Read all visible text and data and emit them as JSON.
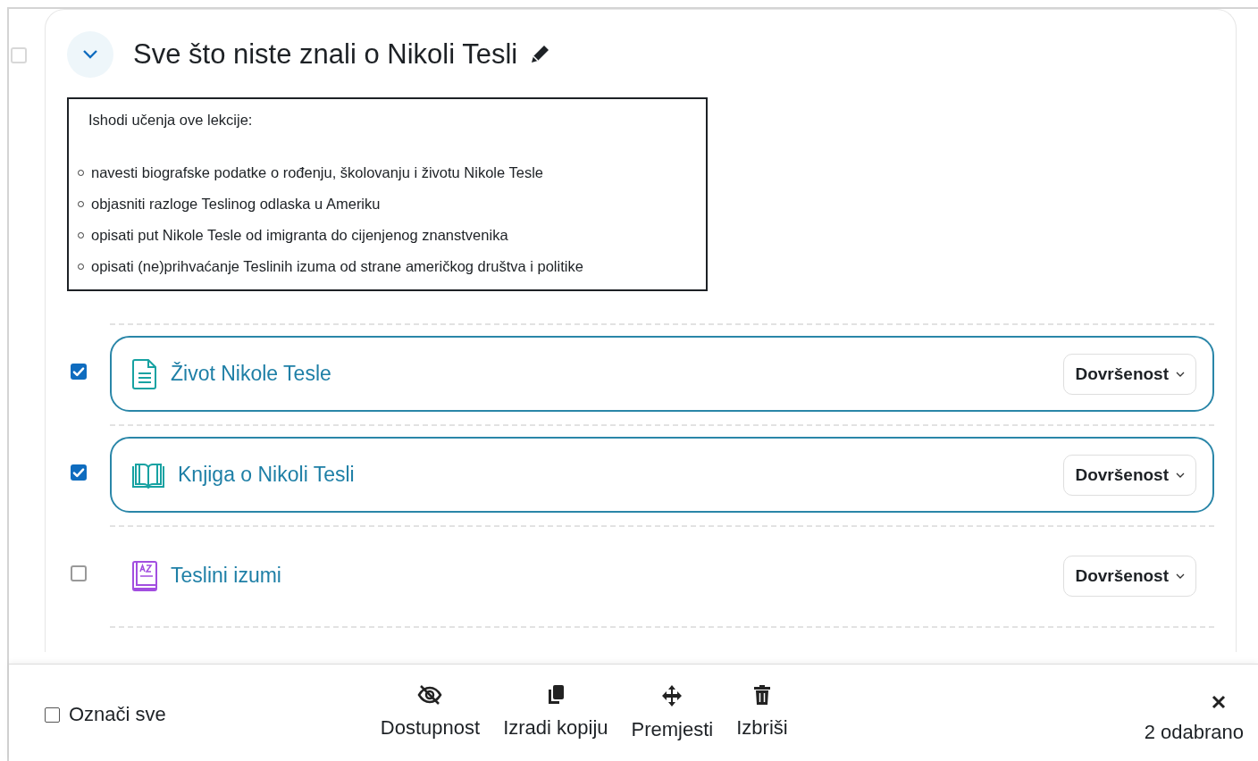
{
  "section": {
    "checked": false,
    "expanded": true,
    "title": "Sve što niste znali o Nikoli Tesli",
    "summary": {
      "heading": "Ishodi učenja ove lekcije:",
      "outcomes": [
        "navesti biografske podatke o rođenju, školovanju i životu Nikole Tesle",
        "objasniti razloge Teslinog odlaska u Ameriku",
        "opisati put Nikole Tesle od imigranta do cijenjenog znanstvenika",
        "opisati (ne)prihvaćanje Teslinih izuma od strane američkog društva i politike"
      ]
    },
    "activities": [
      {
        "kind": "page",
        "name": "Život Nikole Tesle",
        "checked": true,
        "completion": "Dovršenost"
      },
      {
        "kind": "book",
        "name": "Knjiga o Nikoli Tesli",
        "checked": true,
        "completion": "Dovršenost"
      },
      {
        "kind": "glossary",
        "name": "Teslini izumi",
        "checked": false,
        "completion": "Dovršenost"
      }
    ]
  },
  "bulk_bar": {
    "select_all": {
      "label": "Označi sve",
      "checked": false
    },
    "actions": [
      {
        "kind": "visibility",
        "label": "Dostupnost"
      },
      {
        "kind": "copy",
        "label": "Izradi kopiju"
      },
      {
        "kind": "move",
        "label": "Premjesti"
      },
      {
        "kind": "delete",
        "label": "Izbriši"
      }
    ],
    "selected_count": "2 odabrano"
  }
}
